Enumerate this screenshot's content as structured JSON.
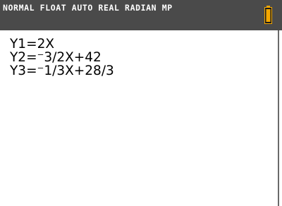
{
  "status_bar": {
    "mode_text": "NORMAL FLOAT AUTO REAL RADIAN MP",
    "battery_icon": "battery-icon",
    "battery_fill_color": "#f5a800",
    "background_color": "#4a4a4a"
  },
  "home_screen": {
    "lines": [
      "Y1=2X",
      "Y2=⁻3∕2X+42",
      "Y3=⁻1∕3X+28∕3"
    ]
  }
}
